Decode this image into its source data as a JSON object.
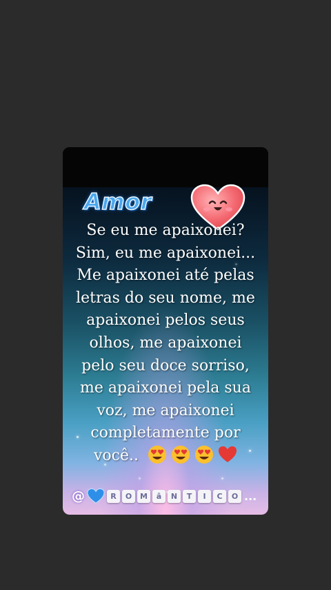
{
  "title": "Amor",
  "poem_lines": [
    "Se eu me apaixonei?",
    "Sim, eu me apaixonei...",
    "Me apaixonei até pelas",
    "letras do seu nome, me",
    "apaixonei pelos seus",
    "olhos, me apaixonei",
    "pelo seu doce sorriso,",
    "me apaixonei pela sua",
    "voz, me apaixonei",
    "completamente por",
    "você.."
  ],
  "footer": {
    "at": "@",
    "letters": [
      "R",
      "O",
      "M",
      "â",
      "N",
      "T",
      "I",
      "C",
      "O"
    ],
    "ellipsis": "..."
  },
  "icons": {
    "title_heart": "smiling-heart-icon",
    "emojis": [
      "heart-eyes-emoji",
      "heart-eyes-emoji",
      "heart-eyes-emoji",
      "red-heart-emoji"
    ],
    "footer_heart": "blue-heart-icon"
  },
  "colors": {
    "background": "#2b2b2b",
    "title_blue": "#4aa7ee",
    "heart_pink": "#f46a72",
    "text": "#ffffff"
  }
}
